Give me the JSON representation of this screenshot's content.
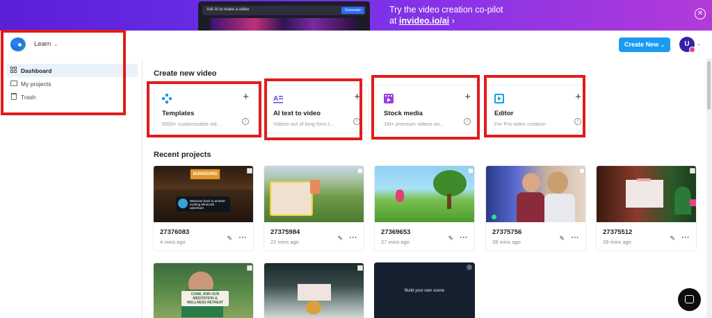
{
  "banner": {
    "mock_prompt": "Ask AI to make a video",
    "mock_button": "Generate",
    "line1": "Try the video creation co-pilot",
    "line2_prefix": "at ",
    "link": "invideo.io/ai",
    "line2_suffix": " ›",
    "close_icon": "close-circle-icon"
  },
  "header": {
    "learn_label": "Learn",
    "create_button": "Create New",
    "avatar_initial": "U"
  },
  "sidebar": {
    "items": [
      {
        "label": "Dashboard",
        "icon": "dashboard-icon",
        "active": true
      },
      {
        "label": "My projects",
        "icon": "folder-icon",
        "active": false
      },
      {
        "label": "Trash",
        "icon": "trash-icon",
        "active": false
      }
    ]
  },
  "create_section": {
    "title": "Create new video",
    "cards": [
      {
        "title": "Templates",
        "subtitle": "5000+ customizable vid...",
        "icon": "templates-icon",
        "color": "#1a9bf0"
      },
      {
        "title": "AI text to video",
        "subtitle": "Videos out of long form t...",
        "icon": "ai-text-icon",
        "color": "#6a3fe0"
      },
      {
        "title": "Stock media",
        "subtitle": "1M+ premium videos an...",
        "icon": "stock-media-icon",
        "color": "#9b3fe0"
      },
      {
        "title": "Editor",
        "subtitle": "For Pro video creation",
        "icon": "editor-icon",
        "color": "#1a9bf0"
      }
    ]
  },
  "recent_section": {
    "title": "Recent projects",
    "projects": [
      {
        "name": "27376083",
        "time": "4 mins ago",
        "thumb_text": "Welcome back to another exciting Minecraft adventure",
        "thumb_logo": "DUNGEONS"
      },
      {
        "name": "27375984",
        "time": "22 mins ago"
      },
      {
        "name": "27369653",
        "time": "27 mins ago"
      },
      {
        "name": "27375756",
        "time": "28 mins ago"
      },
      {
        "name": "27375512",
        "time": "28 mins ago"
      }
    ],
    "row2": [
      {
        "thumb_text": "COME JOIN OUR MEDITATION & WELLNESS RETREAT"
      },
      {
        "thumb_text": ""
      },
      {
        "thumb_text": "Build your own scene"
      }
    ]
  },
  "colors": {
    "accent": "#1a9bf0",
    "highlight": "#e21b1b",
    "avatar": "#3a1fa8"
  }
}
